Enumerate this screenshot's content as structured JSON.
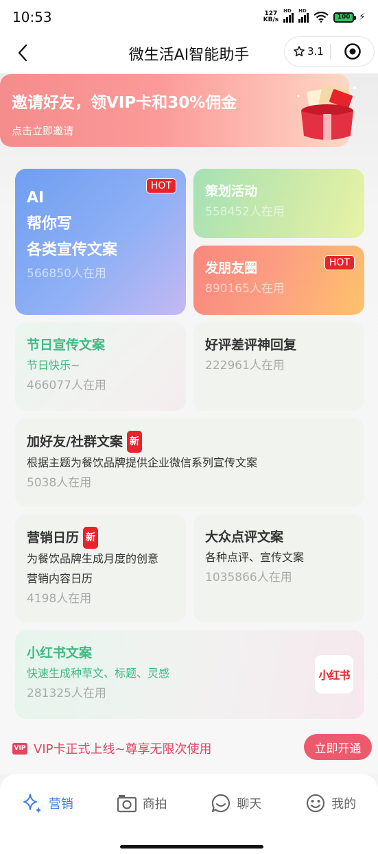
{
  "status_bar": {
    "time": "10:53",
    "net_speed_value": "127",
    "net_speed_unit": "KB/s",
    "battery": "100"
  },
  "nav": {
    "title": "微生活AI智能助手",
    "rating": "3.1"
  },
  "banner": {
    "title": "邀请好友，领VIP卡和30%佣金",
    "subtitle": "点击立即邀请"
  },
  "cards": {
    "ai_write": {
      "line1": "AI",
      "line2": "帮你写",
      "line3": "各类宣传文案",
      "users": "566850人在用",
      "badge": "HOT"
    },
    "plan_activity": {
      "title": "策划活动",
      "users": "558452人在用"
    },
    "moments": {
      "title": "发朋友圈",
      "users": "890165人在用",
      "badge": "HOT"
    },
    "festival": {
      "title": "节日宣传文案",
      "desc": "节日快乐~",
      "users": "466077人在用"
    },
    "review_reply": {
      "title": "好评差评神回复",
      "users": "222961人在用"
    },
    "add_friend": {
      "title": "加好友/社群文案",
      "badge": "新",
      "desc": "根据主题为餐饮品牌提供企业微信系列宣传文案",
      "users": "5038人在用"
    },
    "calendar": {
      "title": "营销日历",
      "badge": "新",
      "desc1": "为餐饮品牌生成月度的创意",
      "desc2": "营销内容日历",
      "users": "4198人在用"
    },
    "dianping": {
      "title": "大众点评文案",
      "desc": "各种点评、宣传文案",
      "users": "1035866人在用"
    },
    "xiaohongshu": {
      "title": "小红书文案",
      "desc": "快速生成种草文、标题、灵感",
      "users": "281325人在用",
      "logo_text": "小红书"
    }
  },
  "vip": {
    "icon_text": "VIP",
    "text": "VIP卡正式上线~尊享无限次使用",
    "button": "立即开通"
  },
  "tabs": [
    {
      "label": "营销",
      "icon": "sparkle-icon"
    },
    {
      "label": "商拍",
      "icon": "camera-icon"
    },
    {
      "label": "聊天",
      "icon": "chat-icon"
    },
    {
      "label": "我的",
      "icon": "smile-icon"
    }
  ],
  "colors": {
    "accent_blue": "#3f7fe2",
    "hot_red": "#e8242b",
    "green": "#3fba84",
    "vip_pink": "#ee5a6d"
  }
}
